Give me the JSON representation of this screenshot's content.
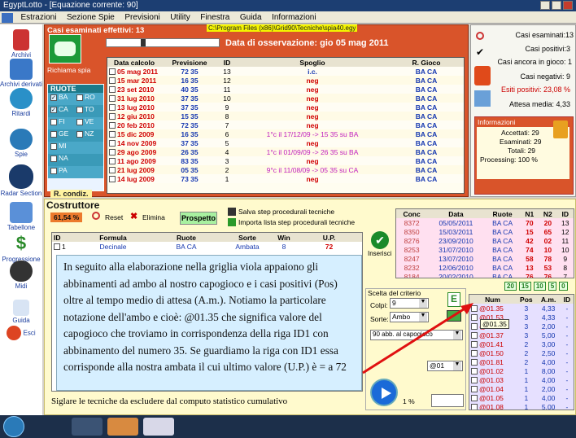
{
  "window": {
    "title": "EgyptLotto - [Equazione corrente: 90]"
  },
  "menu": [
    "Estrazioni",
    "Sezione Spie",
    "Previsioni",
    "Utility",
    "Finestra",
    "Guida",
    "Informazioni"
  ],
  "sidebar": [
    "Archivi",
    "Archivi derivati",
    "Ritardi",
    "Spie",
    "Radar Section",
    "Tabellone",
    "Progressione",
    "Midi",
    "Guida",
    "Esci"
  ],
  "top": {
    "casi_esaminati": "Casi esaminati effettivi: 13",
    "path": "C:\\Program Files (x86)\\Grid90\\Tecniche\\spia40.egy",
    "data_osservazione": "Data di osservazione:  gio 05 mag 2011",
    "richiama": "Richiama spia",
    "ruote_title": "RUOTE",
    "r_condiz": "R. condiz.",
    "ruote": [
      [
        "BA",
        "RO"
      ],
      [
        "CA",
        "TO"
      ],
      [
        "FI",
        "VE"
      ],
      [
        "GE",
        "NZ"
      ],
      [
        "MI",
        ""
      ],
      [
        "NA",
        ""
      ],
      [
        "PA",
        ""
      ]
    ],
    "headers": [
      "Data calcolo",
      "Previsione",
      "ID",
      "Spoglio",
      "R. Gioco"
    ],
    "rows": [
      [
        "05 mag 2011",
        "72 35",
        "13",
        "i.c.",
        "BA CA"
      ],
      [
        "15 mar 2011",
        "16 35",
        "12",
        "neg",
        "BA CA"
      ],
      [
        "23 set 2010",
        "40 35",
        "11",
        "neg",
        "BA CA"
      ],
      [
        "31 lug 2010",
        "37 35",
        "10",
        "neg",
        "BA CA"
      ],
      [
        "13 lug 2010",
        "37 35",
        "9",
        "neg",
        "BA CA"
      ],
      [
        "12 giu 2010",
        "15 35",
        "8",
        "neg",
        "BA CA"
      ],
      [
        "20 feb 2010",
        "72 35",
        "7",
        "neg",
        "BA CA"
      ],
      [
        "15 dic 2009",
        "16 35",
        "6",
        "1°c il 17/12/09 -> 15 35 su BA",
        "BA CA"
      ],
      [
        "14 nov 2009",
        "37 35",
        "5",
        "neg",
        "BA CA"
      ],
      [
        "29 ago 2009",
        "26 35",
        "4",
        "1°c il 01/09/09 -> 26 35 su BA",
        "BA CA"
      ],
      [
        "11 ago 2009",
        "83 35",
        "3",
        "neg",
        "BA CA"
      ],
      [
        "21 lug 2009",
        "05 35",
        "2",
        "9°c il 11/08/09 -> 05 35 su CA",
        "BA CA"
      ],
      [
        "14 lug 2009",
        "73 35",
        "1",
        "neg",
        "BA CA"
      ]
    ]
  },
  "stats": {
    "casi_esaminati": "Casi esaminati:13",
    "casi_positivi": "Casi positivi:3",
    "in_gioco": "Casi ancora in gioco: 1",
    "negativi": "Casi negativi: 9",
    "esiti": "Esiti positivi: 23,08 %",
    "attesa": "Attesa media: 4,33",
    "info_title": "Informazioni",
    "accettati": "Accettati:  29",
    "esaminati": "Esaminati:  29",
    "totali": "Totali:  29",
    "processing": "Processing:  100 %"
  },
  "costruttore": {
    "title": "Costruttore",
    "pct": "61,54 %",
    "reset": "Reset",
    "elimina": "Elimina",
    "prospetto": "Prospetto",
    "salva": "Salva step procedurali tecniche",
    "importa": "Importa lista step procedurali tecniche",
    "inserisci": "Inserisci",
    "headers": [
      "ID",
      "Formula",
      "Ruote",
      "Sorte",
      "Win",
      "U.P."
    ],
    "row": [
      "1",
      "Decinale",
      "BA CA",
      "Ambata",
      "8",
      "72"
    ]
  },
  "note": "In seguito alla elaborazione nella griglia viola appaiono gli abbinamenti ad ambo al nostro capogioco e i casi positivi (Pos) oltre al tempo medio di attesa (A.m.). Notiamo la particolare notazione dell'ambo e cioè: @01.35 che significa valore del capogioco che troviamo in corrispondenza della riga ID1 con abbinamento del numero 35. Se guardiamo la riga con ID1 essa corrisponde alla nostra ambata il cui ultimo valore (U.P.) è = a 72",
  "footer": "Siglare le tecniche da escludere dal computo statistico cumulativo",
  "criterio": {
    "title": "Scelta del criterio",
    "colpi_label": "Colpi:",
    "colpi": "9",
    "sorte_label": "Sorte:",
    "sorte": "Ambo",
    "abb": "90 abb. al capogioco",
    "sel": "@01",
    "pct": "1 %"
  },
  "conc": {
    "headers": [
      "Conc",
      "Data",
      "Ruote",
      "N1",
      "N2",
      "ID"
    ],
    "rows": [
      [
        "8372",
        "05/05/2011",
        "BA CA",
        "70",
        "20",
        "13"
      ],
      [
        "8350",
        "15/03/2011",
        "BA CA",
        "15",
        "65",
        "12"
      ],
      [
        "8276",
        "23/09/2010",
        "BA CA",
        "42",
        "02",
        "11"
      ],
      [
        "8253",
        "31/07/2010",
        "BA CA",
        "74",
        "10",
        "10"
      ],
      [
        "8247",
        "13/07/2010",
        "BA CA",
        "58",
        "78",
        "9"
      ],
      [
        "8232",
        "12/06/2010",
        "BA CA",
        "13",
        "53",
        "8"
      ],
      [
        "8184",
        "20/02/2010",
        "BA CA",
        "76",
        "76",
        "7"
      ]
    ],
    "counters": [
      "20",
      "15",
      "10",
      "5",
      "0"
    ]
  },
  "ambi": {
    "headers": [
      "Num",
      "Pos",
      "A.m.",
      "ID"
    ],
    "tooltip": "@01.35",
    "rows": [
      [
        "@01.35",
        "3",
        "4,33",
        "-"
      ],
      [
        "@01.53",
        "3",
        "4,33",
        "-"
      ],
      [
        "@01.60",
        "3",
        "2,00",
        "-"
      ],
      [
        "@01.37",
        "3",
        "5,00",
        "-"
      ],
      [
        "@01.41",
        "2",
        "3,00",
        "-"
      ],
      [
        "@01.50",
        "2",
        "2,50",
        "-"
      ],
      [
        "@01.81",
        "2",
        "4,00",
        "-"
      ],
      [
        "@01.02",
        "1",
        "8,00",
        "-"
      ],
      [
        "@01.03",
        "1",
        "4,00",
        "-"
      ],
      [
        "@01.04",
        "1",
        "2,00",
        "-"
      ],
      [
        "@01.05",
        "1",
        "4,00",
        "-"
      ],
      [
        "@01.08",
        "1",
        "5,00",
        "-"
      ]
    ]
  }
}
